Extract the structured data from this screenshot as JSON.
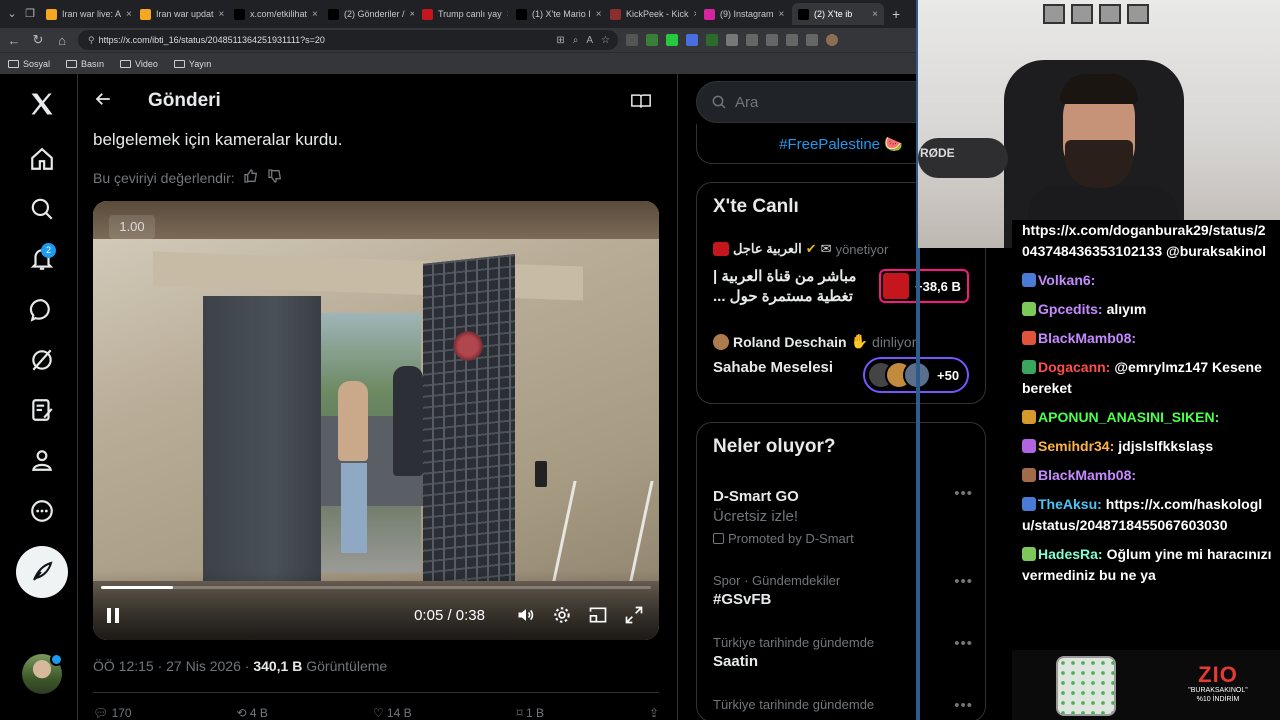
{
  "browser": {
    "tabs": [
      {
        "label": "Iran war live: A",
        "color": "#f5a623",
        "active": false
      },
      {
        "label": "Iran war updat",
        "color": "#f5a623",
        "active": false
      },
      {
        "label": "x.com/etkilihat",
        "color": "#000000",
        "active": false
      },
      {
        "label": "(2) Gönderiler /",
        "color": "#000000",
        "active": false
      },
      {
        "label": "Trump canlı yay",
        "color": "#c4161c",
        "active": false
      },
      {
        "label": "(1) X'te Mario I",
        "color": "#000000",
        "active": false
      },
      {
        "label": "KickPeek - Kick",
        "color": "#8b2e2e",
        "active": false
      },
      {
        "label": "(9) Instagram",
        "color": "#d6249f",
        "active": false
      },
      {
        "label": "(2) X'te ib",
        "color": "#000000",
        "active": true
      }
    ],
    "url": "https://x.com/ibti_16/status/2048511364251931111?s=20",
    "bookmarks": [
      "Sosyal",
      "Basın",
      "Video",
      "Yayın"
    ]
  },
  "nav": {
    "notification_count": "2"
  },
  "post": {
    "header_title": "Gönderi",
    "body_text": "belgelemek için kameralar kurdu.",
    "rate_text": "Bu çeviriyi değerlendir:",
    "video": {
      "speed": "1.00",
      "time": "0:05 / 0:38",
      "progress_fraction": 0.13
    },
    "timestamp": "ÖÖ 12:15 · 27 Nis 2026 · ",
    "views_count": "340,1 B",
    "views_label": " Görüntüleme",
    "actions": {
      "replies": "170",
      "reposts": "4 B",
      "likes": "14 B",
      "bookmarks": "1 B"
    }
  },
  "sidebar": {
    "search_placeholder": "Ara",
    "hashtag": "#FreePalestine 🍉",
    "live": {
      "title": "X'te Canlı",
      "host1_name": "العربية عاجل",
      "host1_action": "yönetiyor",
      "host1_title": "مباشر من قناة العربية | تغطية مستمرة حول ...",
      "host1_count": "+38,6 B",
      "host2_name": "Roland Deschain",
      "host2_action": "dinliyor",
      "host2_title": "Sahabe Meselesi",
      "host2_count": "+50"
    },
    "trends": {
      "title": "Neler oluyor?",
      "items": [
        {
          "meta": "",
          "name": "D-Smart GO",
          "sub": "Ücretsiz izle!",
          "promo": "Promoted by D-Smart"
        },
        {
          "meta": "Spor · Gündemdekiler",
          "name": "#GSvFB",
          "sub": "",
          "promo": ""
        },
        {
          "meta": "Türkiye tarihinde gündemde",
          "name": "Saatin",
          "sub": "",
          "promo": ""
        },
        {
          "meta": "Türkiye tarihinde gündemde",
          "name": "",
          "sub": "",
          "promo": ""
        }
      ]
    }
  },
  "stream": {
    "mic_brand": "RØDE",
    "chat": [
      {
        "user": "",
        "color": "#ffffff",
        "text": "https://x.com/doganburak29/status/2043748436353102133 @buraksakinol"
      },
      {
        "user": "Volkan6:",
        "color": "#c48bff",
        "text": ""
      },
      {
        "user": "Gpcedits:",
        "color": "#c48bff",
        "text": "alıyım"
      },
      {
        "user": "BlackMamb08:",
        "color": "#c48bff",
        "text": ""
      },
      {
        "user": "Dogacann:",
        "color": "#ff4d4d",
        "text": "@emrylmz147 Kesene bereket"
      },
      {
        "user": "APONUN_ANASINI_SIKEN:",
        "color": "#4cff4c",
        "text": ""
      },
      {
        "user": "Semihdr34:",
        "color": "#ffb347",
        "text": "jdjslslfkkslaşs"
      },
      {
        "user": "BlackMamb08:",
        "color": "#c48bff",
        "text": ""
      },
      {
        "user": "TheAksu:",
        "color": "#4fc3f7",
        "text": "https://x.com/haskologlu/status/2048718455067603030"
      },
      {
        "user": "HadesRa:",
        "color": "#7fffd4",
        "text": "Oğlum yine mi haracınızı vermediniz bu ne ya"
      }
    ],
    "sponsor_logo": "ZIO",
    "sponsor_code": "\"BURAKSAKINOL\"",
    "sponsor_discount": "%10 İNDİRİM"
  },
  "colors": {
    "accent": "#1d9bf0",
    "live_pink": "#f91880",
    "live_purple": "#7856ff"
  }
}
